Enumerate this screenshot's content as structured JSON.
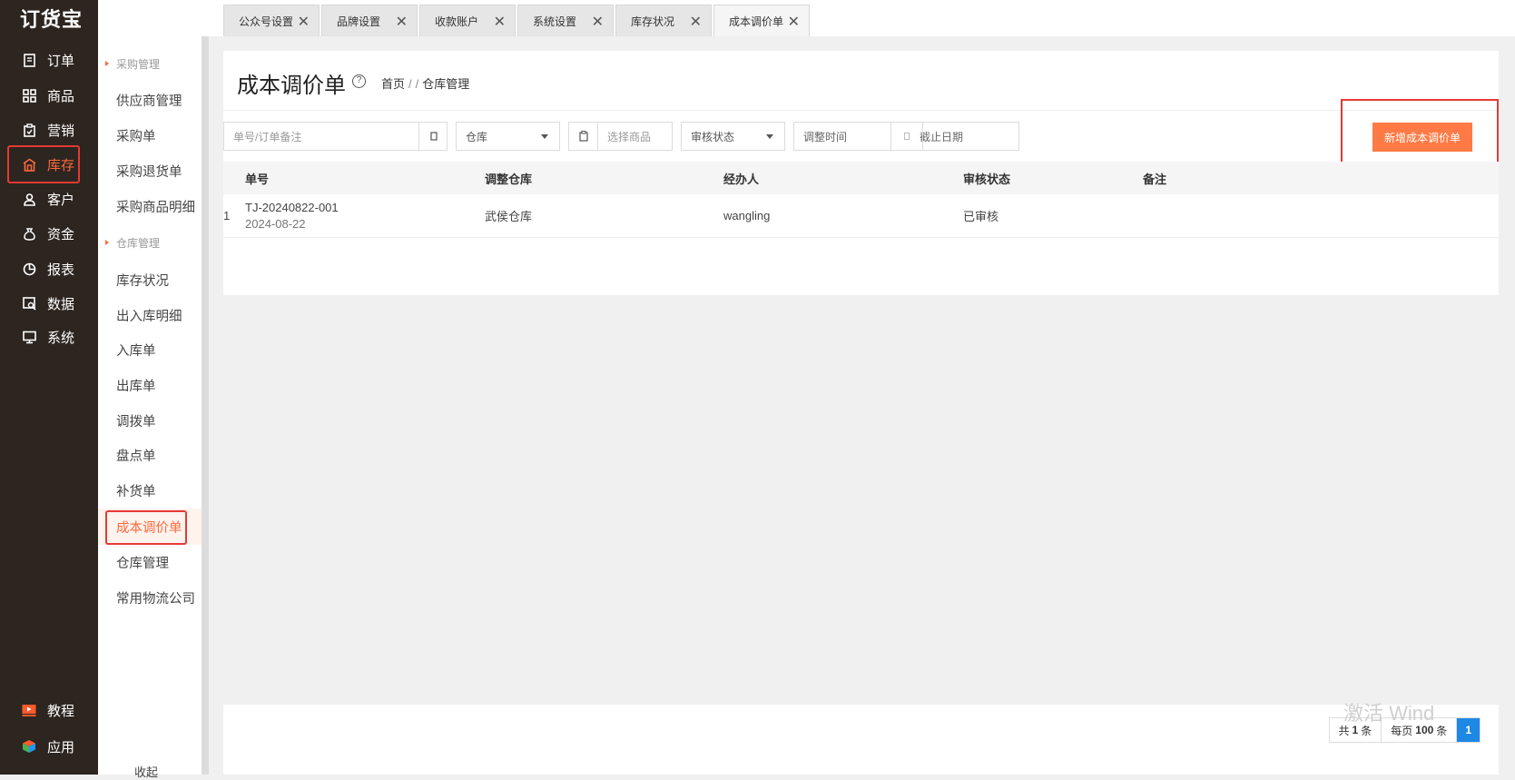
{
  "app": {
    "logo": "订货宝"
  },
  "nav": [
    {
      "label": "订单",
      "icon": "order-icon"
    },
    {
      "label": "商品",
      "icon": "goods-icon"
    },
    {
      "label": "营销",
      "icon": "marketing-icon"
    },
    {
      "label": "库存",
      "icon": "warehouse-icon",
      "active": true
    },
    {
      "label": "客户",
      "icon": "customer-icon"
    },
    {
      "label": "资金",
      "icon": "money-bag-icon"
    },
    {
      "label": "报表",
      "icon": "pie-chart-icon"
    },
    {
      "label": "数据",
      "icon": "data-icon"
    },
    {
      "label": "系统",
      "icon": "monitor-icon"
    }
  ],
  "nav_bottom": [
    {
      "label": "教程",
      "icon": "video-icon"
    },
    {
      "label": "应用",
      "icon": "app-cube-icon"
    }
  ],
  "subnav": {
    "group_purchase": "采购管理",
    "purchase_items": [
      "供应商管理",
      "采购单",
      "采购退货单",
      "采购商品明细"
    ],
    "group_warehouse": "仓库管理",
    "warehouse_items": [
      "库存状况",
      "出入库明细",
      "入库单",
      "出库单",
      "调拨单",
      "盘点单",
      "补货单",
      "成本调价单",
      "仓库管理",
      "常用物流公司"
    ],
    "active": "成本调价单",
    "footer": "收起"
  },
  "tabs": [
    {
      "label": "公众号设置"
    },
    {
      "label": "品牌设置"
    },
    {
      "label": "收款账户"
    },
    {
      "label": "系统设置"
    },
    {
      "label": "库存状况"
    },
    {
      "label": "成本调价单",
      "active": true
    }
  ],
  "page": {
    "title": "成本调价单",
    "breadcrumb": [
      "首页",
      "/",
      "/",
      "仓库管理"
    ]
  },
  "filters": {
    "search_placeholder": "单号/订单备注",
    "warehouse": "仓库",
    "goods_placeholder": "选择商品",
    "audit_status": "审核状态",
    "adjust_time": "调整时间",
    "end_date": "截止日期"
  },
  "actions": {
    "new_button": "新增成本调价单"
  },
  "table": {
    "headers": [
      "单号",
      "调整仓库",
      "经办人",
      "审核状态",
      "备注"
    ],
    "rows": [
      {
        "index": "1",
        "no": "TJ-20240822-001",
        "date": "2024-08-22",
        "warehouse": "武侯仓库",
        "handler": "wangling",
        "status": "已审核",
        "remark": ""
      }
    ]
  },
  "pagination": {
    "total_prefix": "共",
    "total": "1",
    "total_suffix": "条",
    "per_page_prefix": "每页",
    "per_page": "100",
    "per_page_suffix": "条",
    "current": "1"
  },
  "watermark": "激活 Wind",
  "colors": {
    "accent": "#ff7a45",
    "nav_bg": "#2c2520",
    "highlight": "#e53935",
    "page_blue": "#1e88e5"
  }
}
